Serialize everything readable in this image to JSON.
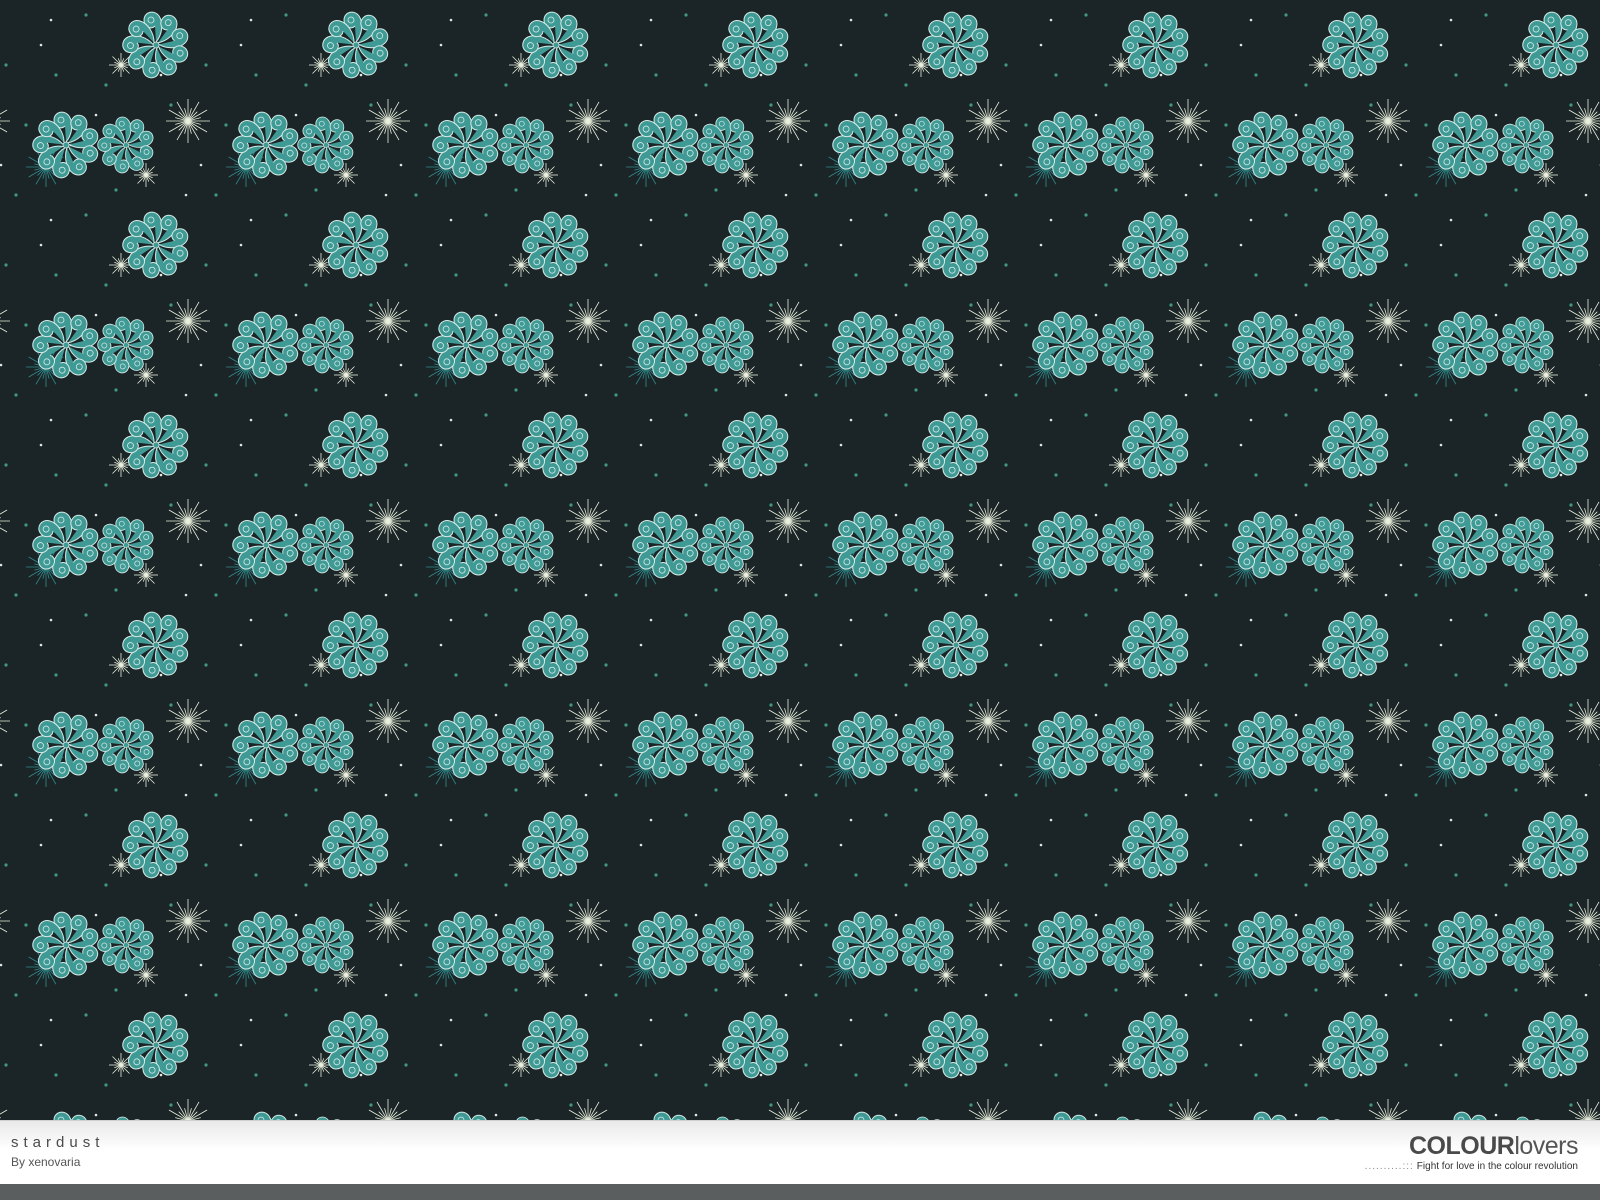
{
  "pattern": {
    "name": "stardust",
    "author": "By xenovaria",
    "colors": {
      "background": "#1b2426",
      "petal": "#3f9a96",
      "petal_outline": "#d6ece6",
      "star_cream": "#e8efdc",
      "star_teal": "#2f8c8e",
      "dot_green": "#3f9a7e",
      "dot_white": "#dfe8e0"
    }
  },
  "brand": {
    "logo_bold": "COLOUR",
    "logo_light": "lovers",
    "tagline": "Fight for love in the colour revolution",
    "dots": "..........:::"
  }
}
